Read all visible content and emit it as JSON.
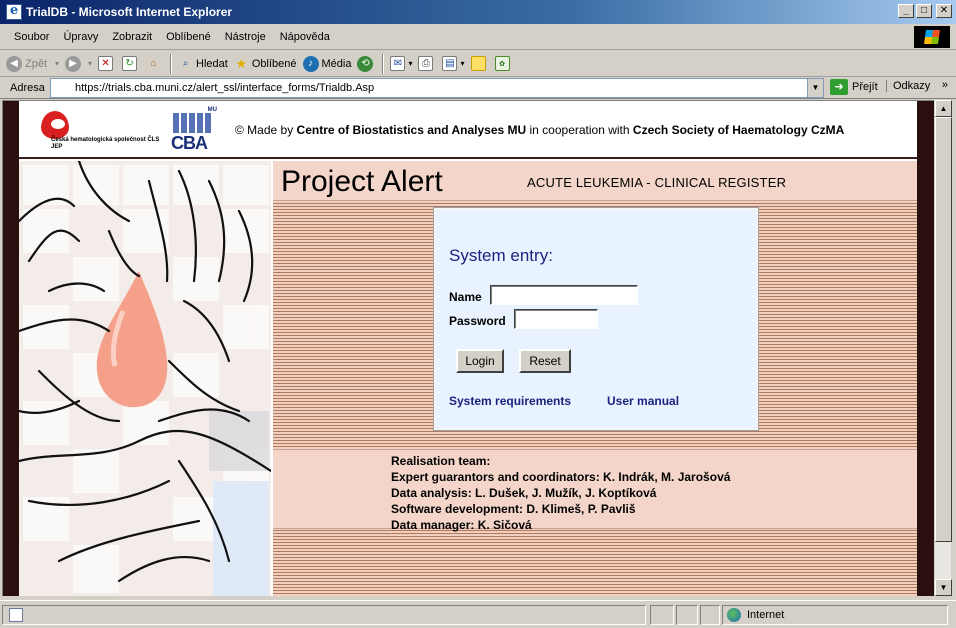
{
  "window": {
    "title": "TrialDB - Microsoft Internet Explorer"
  },
  "menu": [
    "Soubor",
    "Úpravy",
    "Zobrazit",
    "Oblíbené",
    "Nástroje",
    "Nápověda"
  ],
  "toolbar": {
    "back": "Zpět",
    "search": "Hledat",
    "favorites": "Oblíbené",
    "media": "Média"
  },
  "address": {
    "label": "Adresa",
    "url": "https://trials.cba.muni.cz/alert_ssl/interface_forms/Trialdb.Asp",
    "go": "Přejít",
    "links": "Odkazy"
  },
  "header": {
    "cshs_logo_text": "Česká hematologická společnost ČLS JEP",
    "cba_mu": "MU",
    "cba_logo": "CBA",
    "credits_prefix": "© Made by ",
    "credits_org1": "Centre of Biostatistics and Analyses MU",
    "credits_mid": " in cooperation with ",
    "credits_org2": "Czech Society of Haematology CzMA"
  },
  "project": {
    "title": "Project Alert",
    "register": "ACUTE LEUKEMIA - CLINICAL REGISTER"
  },
  "login": {
    "heading": "System entry:",
    "name_label": "Name",
    "name_value": "",
    "password_label": "Password",
    "password_value": "",
    "login_button": "Login",
    "reset_button": "Reset",
    "link_requirements": "System requirements",
    "link_manual": "User manual"
  },
  "team": {
    "heading": "Realisation team:",
    "line1": "Expert guarantors and coordinators: K. Indrák, M. Jarošová",
    "line2": "Data analysis: L. Dušek, J. Mužík, J. Koptíková",
    "line3": "Software development: D. Klimeš, P. Pavliš",
    "line4": "Data manager: K. Sičová"
  },
  "status": {
    "zone": "Internet"
  }
}
